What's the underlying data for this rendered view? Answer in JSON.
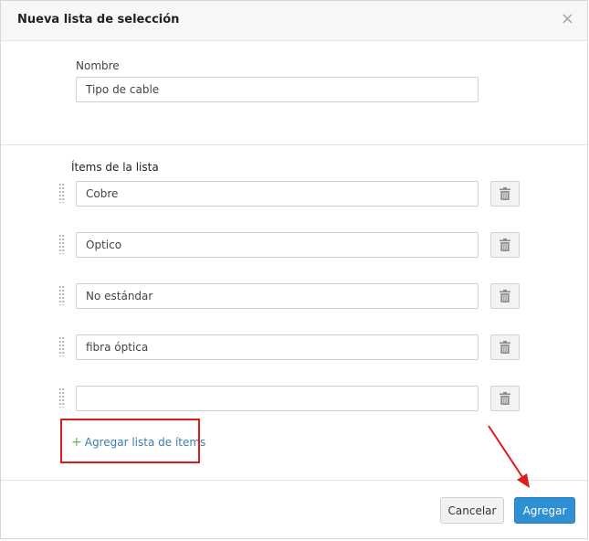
{
  "dialog": {
    "title": "Nueva lista de selección",
    "close_symbol": "×"
  },
  "form": {
    "name_label": "Nombre",
    "name_value": "Tipo de cable",
    "items_label": "Ítems de la lista",
    "items": [
      {
        "value": "Cobre"
      },
      {
        "value": "Óptico"
      },
      {
        "value": "No estándar"
      },
      {
        "value": "fibra óptica"
      },
      {
        "value": ""
      }
    ],
    "add_link_plus": "+",
    "add_link_label": "Agregar lista de ítems"
  },
  "footer": {
    "cancel_label": "Cancelar",
    "add_label": "Agregar"
  },
  "colors": {
    "primary_button": "#2f8fd3",
    "annotation_red": "#e01b1b",
    "link": "#3a7fb0",
    "plus": "#5cb85c"
  },
  "icons": [
    "close-icon",
    "drag-handle-icon",
    "trash-icon",
    "plus-icon",
    "annotation-arrow"
  ]
}
